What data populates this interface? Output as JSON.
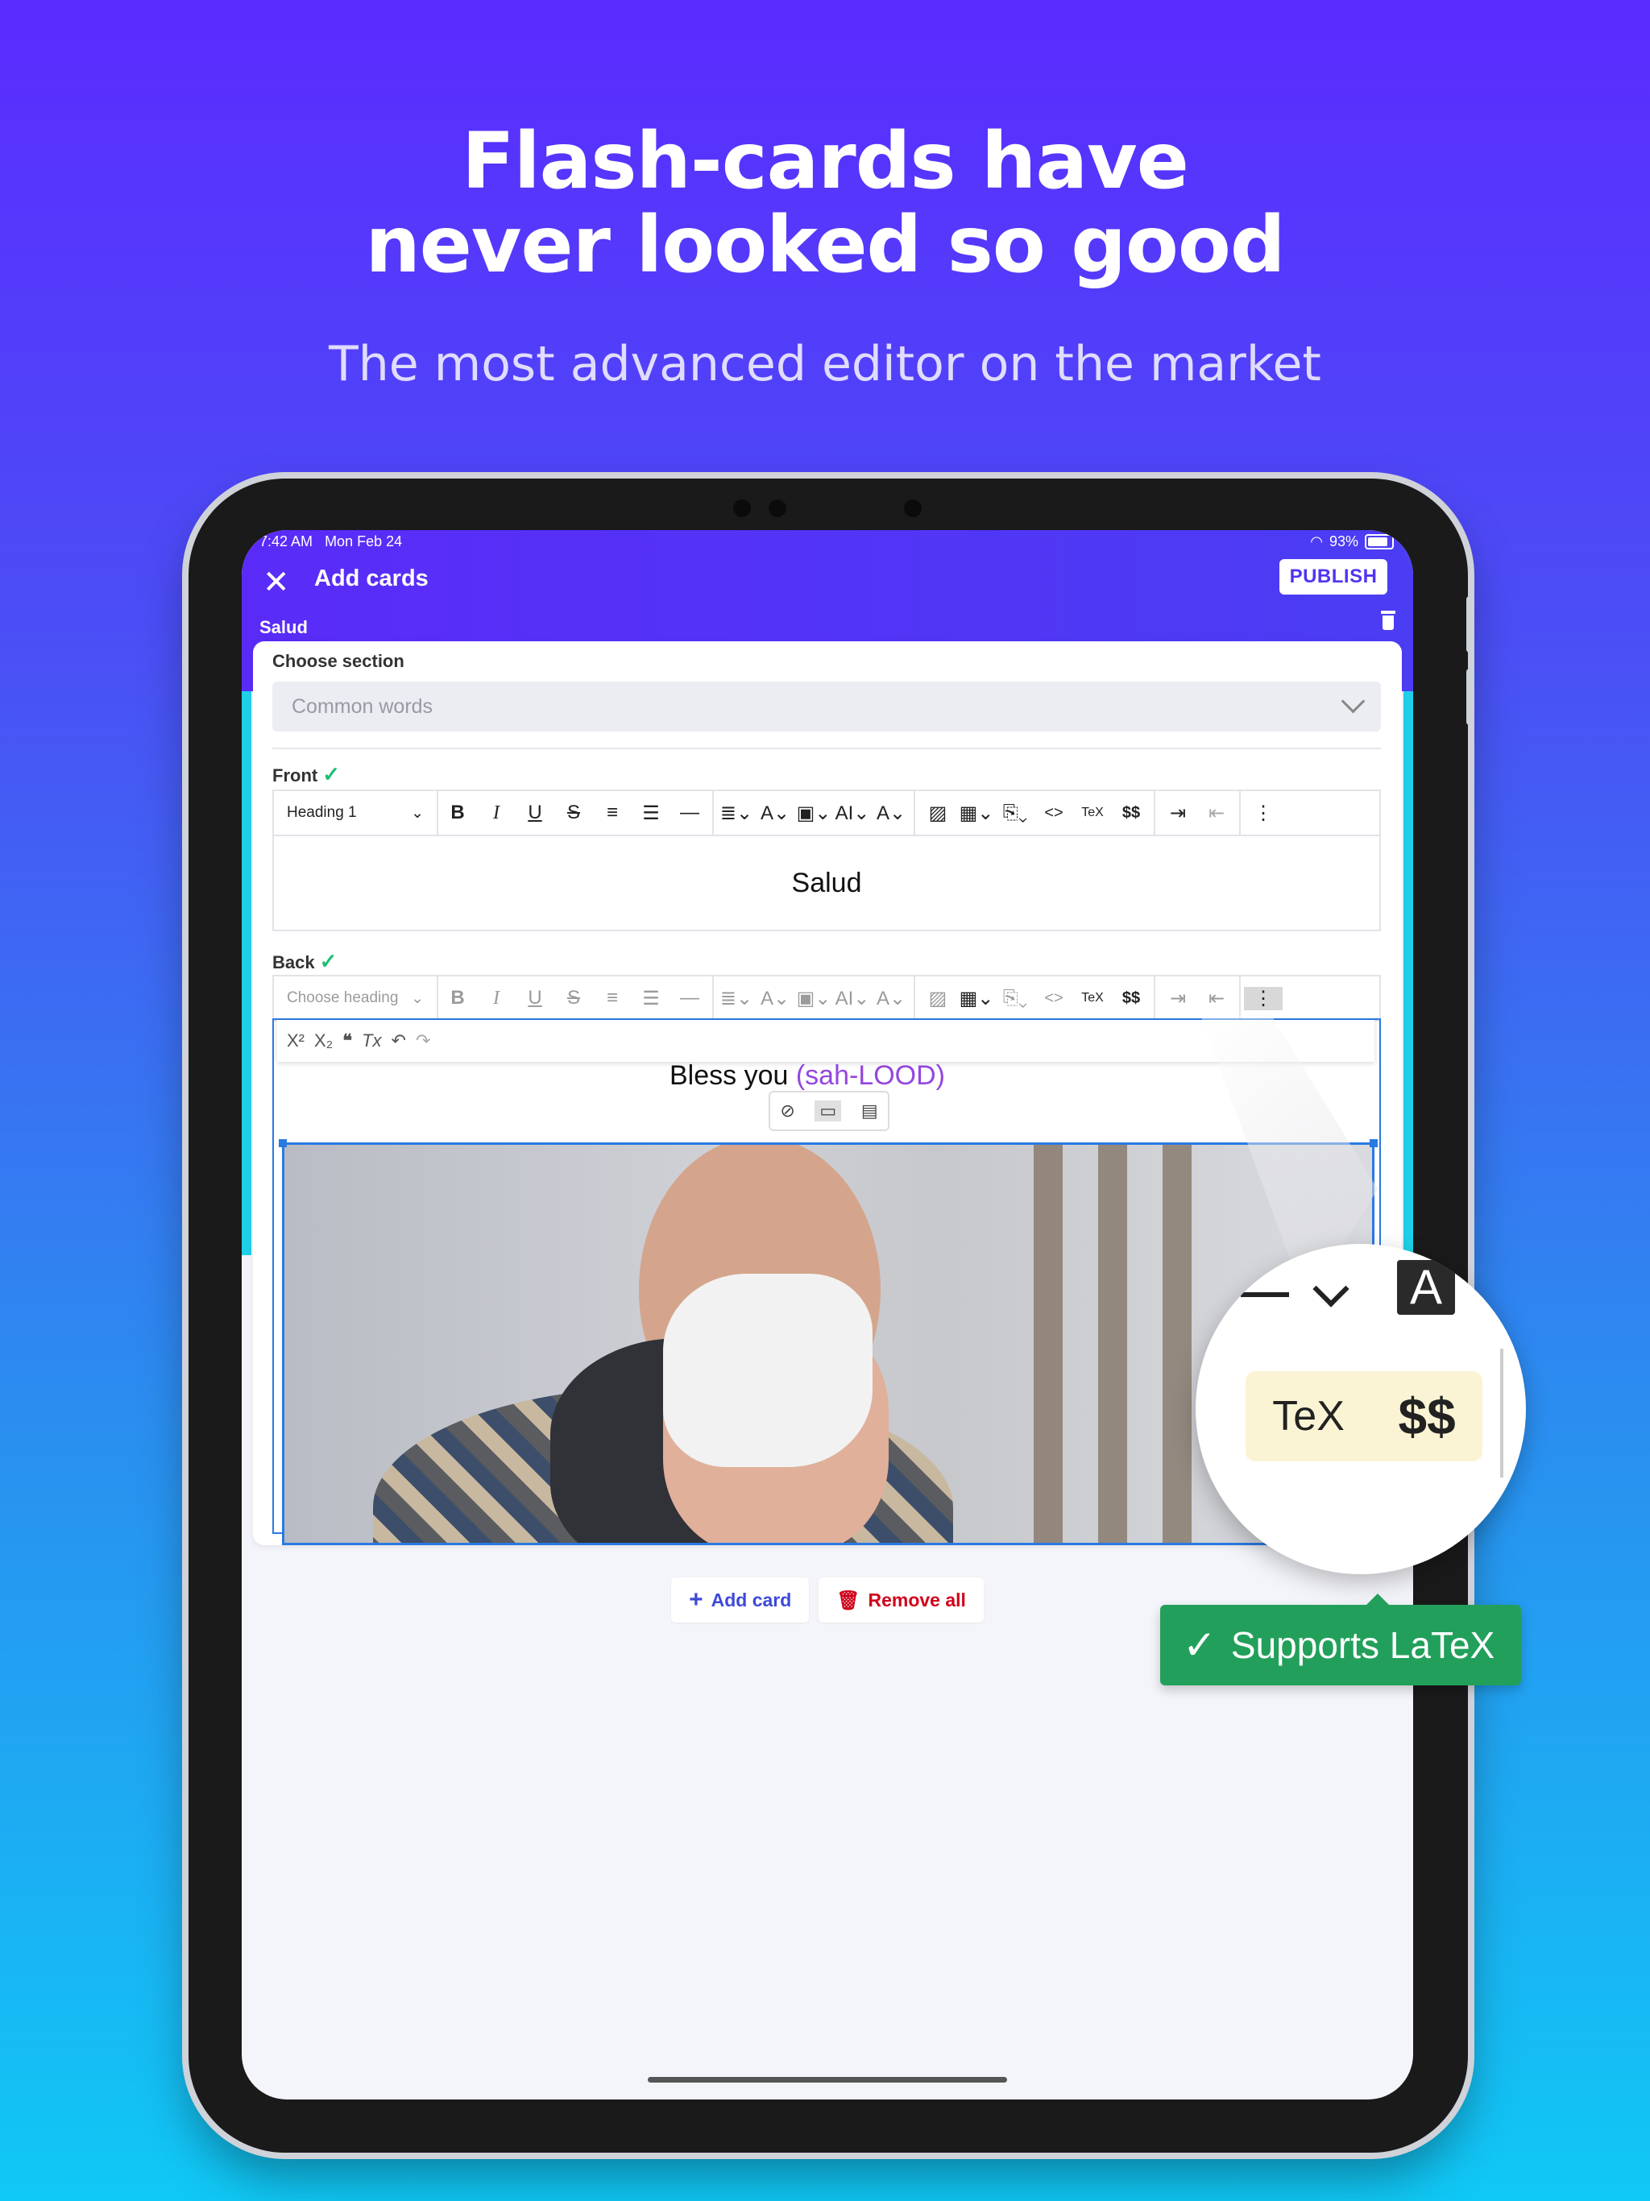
{
  "marketing": {
    "headline_line1": "Flash-cards have",
    "headline_line2": "never looked so good",
    "subheadline": "The most advanced editor on the market"
  },
  "status_bar": {
    "time": "7:42 AM",
    "date": "Mon Feb 24",
    "battery": "93%"
  },
  "app_bar": {
    "title": "Add cards",
    "publish_label": "PUBLISH",
    "deck_name": "Salud"
  },
  "section": {
    "label": "Choose section",
    "value": "Common words"
  },
  "front": {
    "label": "Front",
    "heading_select": "Heading 1",
    "content": "Salud"
  },
  "back": {
    "label": "Back",
    "heading_select": "Choose heading",
    "content_main": "Bless you",
    "content_pronunciation": "(sah-LOOD)"
  },
  "toolbar": {
    "bold": "B",
    "italic": "I",
    "underline": "U",
    "strike": "S",
    "code": "<>",
    "tex": "TeX",
    "dollar": "$$",
    "more": "⋮"
  },
  "sub_toolbar": [
    "X²",
    "X₂",
    "❝",
    "Tx",
    "↶",
    "↷"
  ],
  "footer": {
    "add_card": "Add card",
    "remove_all": "Remove all"
  },
  "magnifier": {
    "tex_label": "TeX",
    "dollar_label": "$$"
  },
  "badge": {
    "label": "Supports LaTeX"
  },
  "colors": {
    "primary": "#5a2bf8",
    "remove": "#d0021b",
    "success": "#22a05b"
  }
}
